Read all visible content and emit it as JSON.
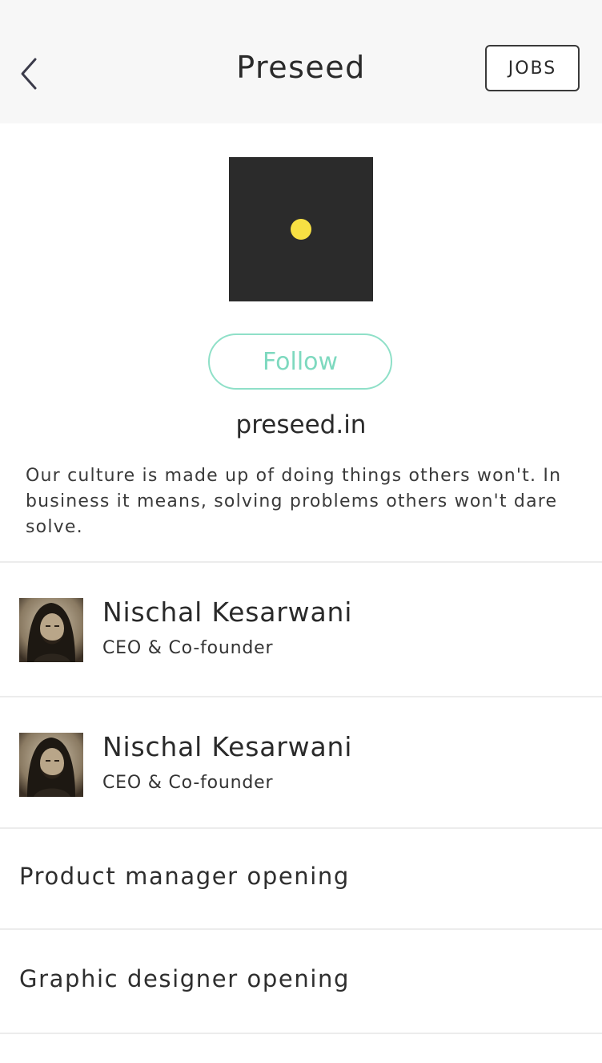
{
  "header": {
    "title": "Preseed",
    "jobs_label": "JOBS"
  },
  "icons": {
    "back": "chevron-left-icon"
  },
  "company": {
    "logo_accent": "#f7e043",
    "follow_label": "Follow",
    "website": "preseed.in",
    "description": "Our culture is made up of doing things others won't. In business it means, solving problems others won't dare solve."
  },
  "people": [
    {
      "name": "Nischal Kesarwani",
      "role": "CEO & Co-founder"
    },
    {
      "name": "Nischal Kesarwani",
      "role": "CEO & Co-founder"
    }
  ],
  "openings": [
    {
      "label": "Product manager opening"
    },
    {
      "label": "Graphic designer opening"
    }
  ],
  "colors": {
    "follow": "#7ed9bf",
    "topbar": "#f7f7f7",
    "logo_bg": "#2b2b2b"
  }
}
